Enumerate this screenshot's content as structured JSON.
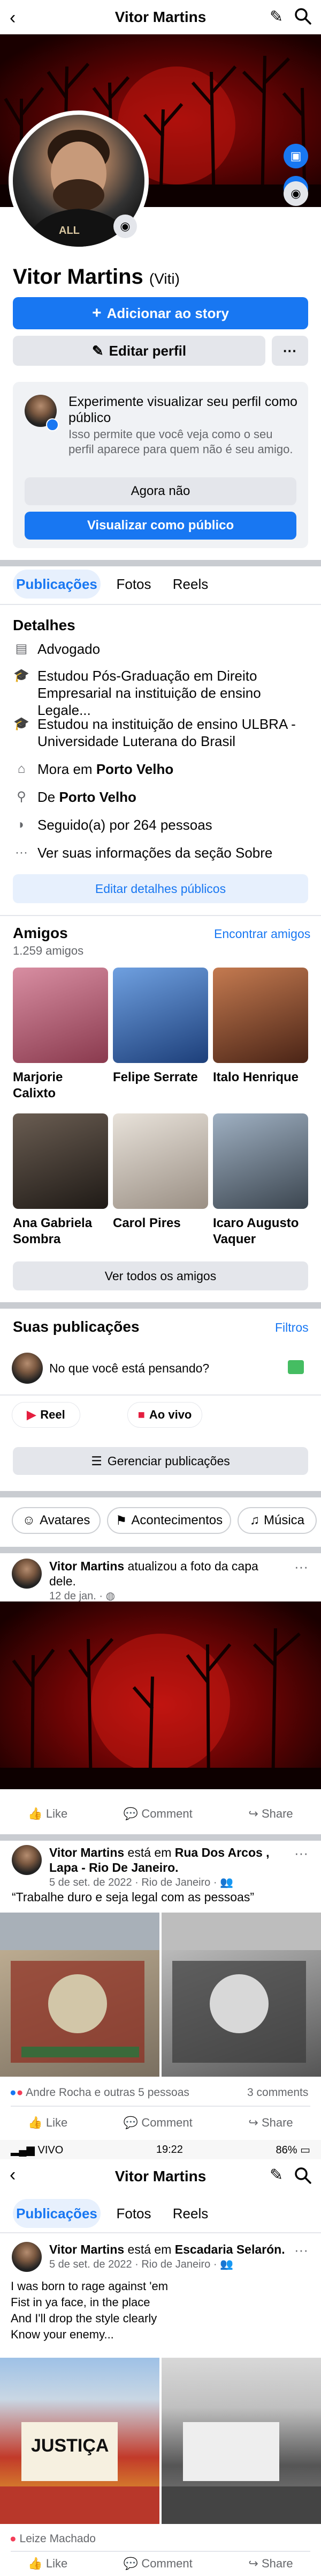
{
  "header": {
    "title": "Vitor Martins"
  },
  "profile": {
    "name": "Vitor Martins",
    "nickname": "(Viti)"
  },
  "buttons": {
    "add_story": "Adicionar ao story",
    "edit_profile": "Editar perfil",
    "more": "···"
  },
  "preview_card": {
    "title": "Experimente visualizar seu perfil como público",
    "body": "Isso permite que você veja como o seu perfil aparece para quem não é seu amigo.",
    "not_now": "Agora não",
    "view_public": "Visualizar como público"
  },
  "tabs": [
    "Publicações",
    "Fotos",
    "Reels"
  ],
  "details": {
    "heading": "Detalhes",
    "items": [
      {
        "icon": "briefcase-icon",
        "text": "Advogado"
      },
      {
        "icon": "graduation-icon",
        "text": "Estudou Pós-Graduação em Direito Empresarial na instituição de ensino Legale..."
      },
      {
        "icon": "graduation-icon",
        "text": "Estudou na instituição de ensino ULBRA - Universidade Luterana do Brasil"
      },
      {
        "icon": "home-icon",
        "prefix": "Mora em ",
        "bold": "Porto Velho"
      },
      {
        "icon": "location-icon",
        "prefix": "De ",
        "bold": "Porto Velho"
      },
      {
        "icon": "rss-icon",
        "text": "Seguido(a) por 264 pessoas"
      },
      {
        "icon": "more-icon",
        "text": "Ver suas informações da seção Sobre"
      }
    ],
    "edit_button": "Editar detalhes públicos"
  },
  "friends": {
    "heading": "Amigos",
    "count": "1.259 amigos",
    "find": "Encontrar amigos",
    "items": [
      {
        "name": "Marjorie Calixto",
        "color": "#b3556a"
      },
      {
        "name": "Felipe Serrate",
        "color": "#3a6bb5"
      },
      {
        "name": "Italo Henrique",
        "color": "#8b4a2e"
      },
      {
        "name": "Ana Gabriela Sombra",
        "color": "#3d3530"
      },
      {
        "name": "Carol Pires",
        "color": "#c9c2b8"
      },
      {
        "name": "Icaro Augusto Vaquer",
        "color": "#6e7a86"
      }
    ],
    "see_all": "Ver todos os amigos"
  },
  "posts_section": {
    "heading": "Suas publicações",
    "filters": "Filtros",
    "composer_placeholder": "No que você está pensando?",
    "reel": "Reel",
    "live": "Ao vivo",
    "manage": "Gerenciar publicações"
  },
  "chips": [
    "Avatares",
    "Acontecimentos",
    "Música"
  ],
  "post1": {
    "author": "Vitor Martins",
    "action": " atualizou a foto da capa dele.",
    "time": "12 de jan. · ",
    "actions": [
      "Like",
      "Comment",
      "Share"
    ]
  },
  "post2": {
    "author": "Vitor Martins",
    "action": " está em ",
    "place": "Rua Dos Arcos , Lapa - Rio De Janeiro.",
    "time": "5 de set. de 2022 · Rio de Janeiro · ",
    "text": "“Trabalhe duro e seja legal com as pessoas”",
    "reactions": "Andre Rocha e outras 5 pessoas",
    "comments": "3 comments",
    "actions": [
      "Like",
      "Comment",
      "Share"
    ]
  },
  "statusbar": {
    "carrier": "VIVO",
    "time": "19:22",
    "battery": "86%"
  },
  "post3": {
    "author": "Vitor Martins",
    "action": " está em ",
    "place": "Escadaria Selarón.",
    "time": "5 de set. de 2022 · Rio de Janeiro · ",
    "lines": [
      "I was born to rage against 'em",
      "Fist in ya face, in the place",
      "And I'll drop the style clearly",
      "Know your enemy..."
    ],
    "sign_text": "JUSTIÇA",
    "reactions": "Leize Machado",
    "actions": [
      "Like",
      "Comment",
      "Share"
    ]
  },
  "colors": {
    "accent": "#1877f2",
    "cover": "#8b0000"
  }
}
